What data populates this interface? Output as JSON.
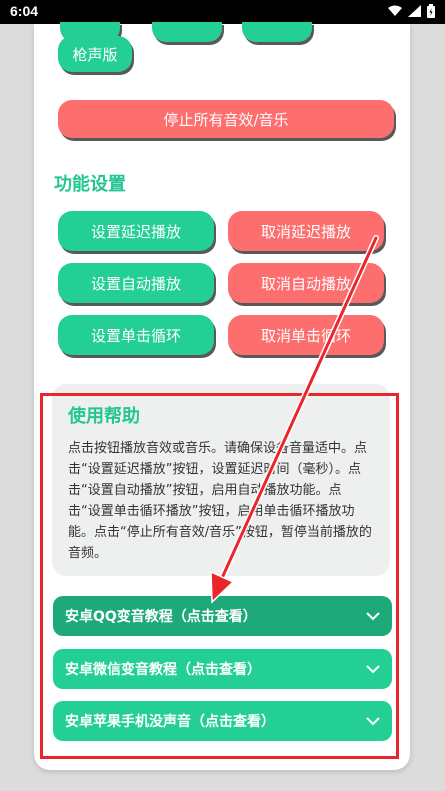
{
  "status_bar": {
    "time": "6:04"
  },
  "sound_buttons": {
    "gunshot": "枪声版",
    "stop_all": "停止所有音效/音乐"
  },
  "settings": {
    "title": "功能设置",
    "set_delay": "设置延迟播放",
    "cancel_delay": "取消延迟播放",
    "set_auto": "设置自动播放",
    "cancel_auto": "取消自动播放",
    "set_loop": "设置单击循环",
    "cancel_loop": "取消单击循环"
  },
  "help": {
    "title": "使用帮助",
    "body": "点击按钮播放音效或音乐。请确保设备音量适中。点击“设置延迟播放”按钮，设置延迟时间（毫秒）。点击“设置自动播放”按钮，启用自动播放功能。点击“设置单击循环播放”按钮，启用单击循环播放功能。点击“停止所有音效/音乐”按钮，暂停当前播放的音频。"
  },
  "tutorials": [
    {
      "label": "安卓QQ变音教程（点击查看）"
    },
    {
      "label": "安卓微信变音教程（点击查看）"
    },
    {
      "label": "安卓苹果手机没声音（点击查看）"
    }
  ],
  "colors": {
    "green": "#24cf96",
    "red": "#fd6e6e",
    "annotation": "#e8262c"
  }
}
